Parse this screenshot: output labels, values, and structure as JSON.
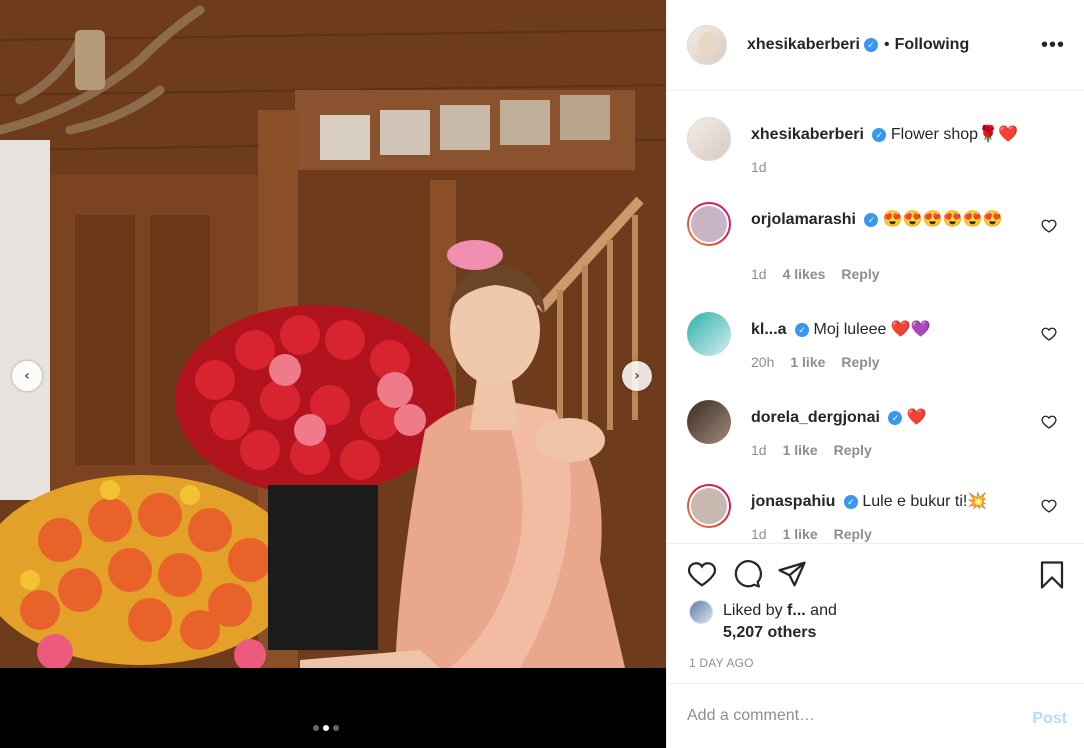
{
  "post": {
    "author": "xhesikaberberi",
    "follow_sep": "•",
    "follow_status": "Following",
    "more": "•••"
  },
  "caption": {
    "username": "xhesikaberberi",
    "text": "Flower shop",
    "emoji": "🌹❤️",
    "time": "1d"
  },
  "comments": [
    {
      "username": "orjolamarashi",
      "text": "😍😍😍😍😍😍",
      "time": "1d",
      "likes": "4 likes",
      "reply": "Reply"
    },
    {
      "username": "kl...a",
      "text": "Moj luleee ❤️💜",
      "time": "20h",
      "likes": "1 like",
      "reply": "Reply"
    },
    {
      "username": "dorela_dergjonai",
      "text": "❤️",
      "time": "1d",
      "likes": "1 like",
      "reply": "Reply"
    },
    {
      "username": "jonaspahiu",
      "text": "Lule e bukur ti!💥",
      "time": "1d",
      "likes": "1 like",
      "reply": "Reply"
    }
  ],
  "likes": {
    "prefix": "Liked by ",
    "by": "f...",
    "suffix": "and",
    "count": "5,207 others"
  },
  "timestamp": "1 DAY AGO",
  "add_comment": {
    "placeholder": "Add a comment…",
    "post_label": "Post"
  },
  "carousel": {
    "total": 3,
    "active": 2
  },
  "icons": {
    "heart": "heart-icon",
    "comment": "comment-icon",
    "share": "share-icon",
    "bookmark": "bookmark-icon",
    "prev": "chevron-left-icon",
    "next": "chevron-right-icon"
  },
  "colors": {
    "accent": "#3897f0",
    "post_disabled": "#b2dffc",
    "muted": "#8e8e8e"
  }
}
